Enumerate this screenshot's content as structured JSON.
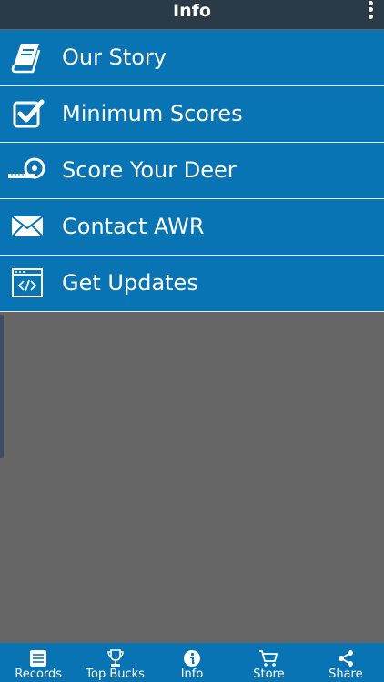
{
  "header": {
    "title": "Info",
    "menu_icon": "overflow-menu-icon"
  },
  "menu": {
    "items": [
      {
        "label": "Our Story",
        "icon": "book-icon"
      },
      {
        "label": "Minimum Scores",
        "icon": "checkbox-icon"
      },
      {
        "label": "Score Your Deer",
        "icon": "tape-measure-icon"
      },
      {
        "label": "Contact AWR",
        "icon": "envelope-icon"
      },
      {
        "label": "Get Updates",
        "icon": "code-window-icon"
      }
    ]
  },
  "tabbar": {
    "tabs": [
      {
        "label": "Records",
        "icon": "list-icon"
      },
      {
        "label": "Top Bucks",
        "icon": "trophy-icon"
      },
      {
        "label": "Info",
        "icon": "info-icon"
      },
      {
        "label": "Store",
        "icon": "cart-icon"
      },
      {
        "label": "Share",
        "icon": "share-icon"
      }
    ]
  },
  "colors": {
    "header_bg": "#2b3a47",
    "accent": "#0874b3",
    "background": "#666666",
    "text": "#ffffff"
  }
}
